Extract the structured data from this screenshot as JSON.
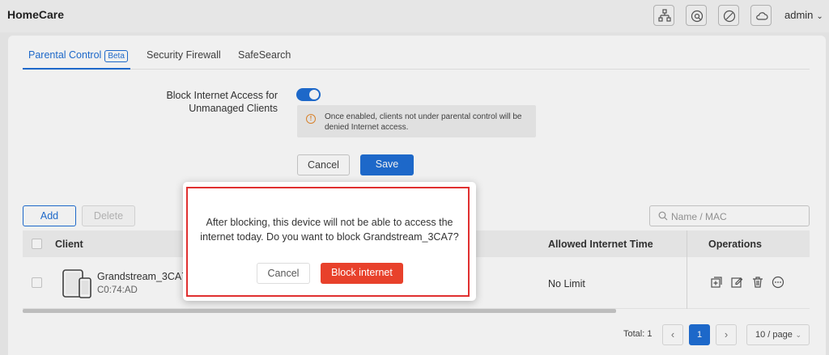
{
  "app": {
    "title": "HomeCare",
    "user": "admin"
  },
  "tabs": [
    {
      "label": "Parental Control",
      "badge": "Beta"
    },
    {
      "label": "Security Firewall"
    },
    {
      "label": "SafeSearch"
    }
  ],
  "form": {
    "block_label": "Block Internet Access for Unmanaged Clients",
    "notice": "Once enabled, clients not under parental control will be denied Internet access.",
    "cancel_label": "Cancel",
    "save_label": "Save"
  },
  "toolbar": {
    "add_label": "Add",
    "delete_label": "Delete",
    "search_placeholder": "Name / MAC"
  },
  "table": {
    "columns": {
      "client": "Client",
      "allowed_time": "Allowed Internet Time",
      "operations": "Operations"
    },
    "rows": [
      {
        "name": "Grandstream_3CA7",
        "mac": "C0:74:AD",
        "allowed_time": "No Limit"
      }
    ]
  },
  "pagination": {
    "total": "Total: 1",
    "current": "1",
    "page_size": "10 / page"
  },
  "dialog": {
    "message": "After blocking, this device will not be able to access the internet today. Do you want to block Grandstream_3CA7?",
    "cancel_label": "Cancel",
    "confirm_label": "Block internet"
  },
  "colors": {
    "accent": "#1f6fd6",
    "danger": "#e8412b",
    "highlight": "#e03030",
    "warning": "#e58a2e"
  },
  "icons": [
    "topology-icon",
    "diagnose-icon",
    "block-icon",
    "cloud-icon",
    "warning-icon",
    "search-icon",
    "tablet-phone-icon",
    "add-copy-icon",
    "edit-icon",
    "trash-icon",
    "more-icon"
  ]
}
